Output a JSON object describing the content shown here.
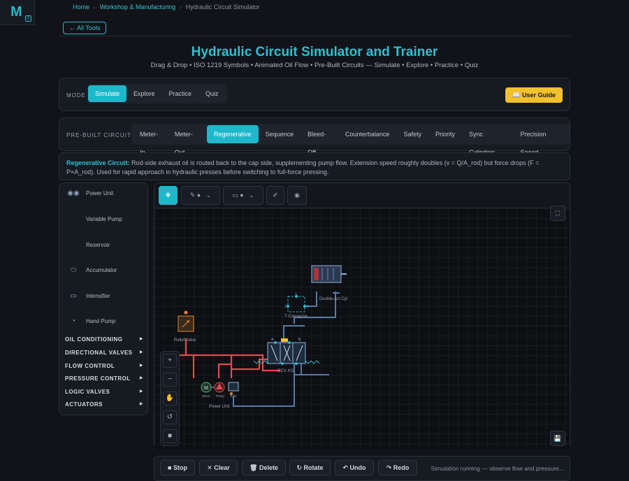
{
  "app": {
    "logo": "M"
  },
  "breadcrumb": {
    "home": "Home",
    "category": "Workshop & Manufacturing",
    "current": "Hydraulic Circuit Simulator"
  },
  "back_label": "← All Tools",
  "header": {
    "title": "Hydraulic Circuit Simulator and Trainer",
    "subtitle": "Drag & Drop • ISO 1219 Symbols • Animated Oil Flow • Pre-Built Circuits — Simulate • Explore • Practice • Quiz"
  },
  "mode": {
    "label": "MODE",
    "options": [
      "Simulate",
      "Explore",
      "Practice",
      "Quiz"
    ],
    "active": "Simulate",
    "guide_label": "📖 User Guide"
  },
  "circuits": {
    "label": "PRE-BUILT CIRCUITS",
    "options": [
      "Meter-In",
      "Meter-Out",
      "Regenerative",
      "Sequence",
      "Bleed-Off",
      "Counterbalance",
      "Safety",
      "Priority",
      "Sync Cylinders",
      "Precision Speed"
    ],
    "active": "Regenerative"
  },
  "description": {
    "heading": "Regenerative Circuit:",
    "text": " Rod-side exhaust oil is routed back to the cap side, supplementing pump flow. Extension speed roughly doubles (v = Q/A_rod) but force drops (F = P×A_rod). Used for rapid approach in hydraulic presses before switching to full-force pressing."
  },
  "palette": {
    "components": [
      {
        "label": "Power Unit",
        "icon": "power-unit-icon"
      },
      {
        "label": "Variable Pump",
        "icon": "variable-pump-icon"
      },
      {
        "label": "Reservoir",
        "icon": "reservoir-icon"
      },
      {
        "label": "Accumulator",
        "icon": "accumulator-icon"
      },
      {
        "label": "Intensifier",
        "icon": "intensifier-icon"
      },
      {
        "label": "Hand Pump",
        "icon": "hand-pump-icon"
      }
    ],
    "categories": [
      "OIL CONDITIONING",
      "DIRECTIONAL VALVES",
      "FLOW CONTROL",
      "PRESSURE CONTROL",
      "LOGIC VALVES",
      "ACTUATORS"
    ]
  },
  "canvas": {
    "labels": {
      "cylinder": "Double-Act Cyl",
      "tconnector": "T-Connector",
      "relief": "Relief Valve",
      "dcv": "DCV 4/3",
      "motor": "Motor",
      "pump": "Pump",
      "tank": "Tank",
      "power_unit": "Power Unit",
      "motor_symbol": "M",
      "port_1": "1",
      "port_2": "2",
      "port_3": "3",
      "port_a": "A",
      "port_b": "B"
    }
  },
  "controls": {
    "stop": "■ Stop",
    "clear": "✕ Clear",
    "delete": "🗑 Delete",
    "rotate": "↻ Rotate",
    "undo": "↶ Undo",
    "redo": "↷ Redo",
    "status": "Simulation running — observe flow and pressure..."
  },
  "colors": {
    "accent": "#1fb8cb",
    "pressure_line": "#e5484d",
    "return_line": "#5a79a8",
    "guide": "#f2c12e"
  }
}
